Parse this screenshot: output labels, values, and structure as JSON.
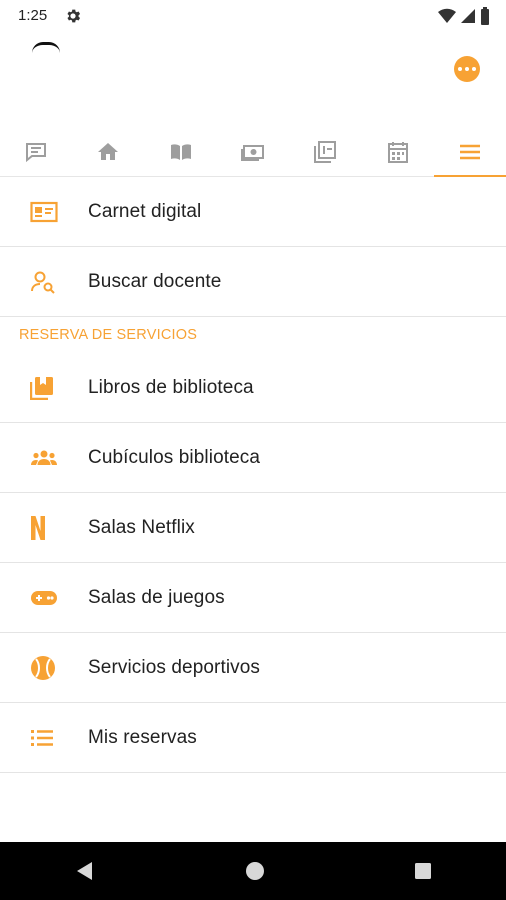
{
  "status_bar": {
    "time": "1:25"
  },
  "header": {
    "more_icon": "more-horizontal-icon"
  },
  "tabs": [
    {
      "icon": "chat-icon",
      "active": false
    },
    {
      "icon": "home-icon",
      "active": false
    },
    {
      "icon": "book-open-icon",
      "active": false
    },
    {
      "icon": "money-icon",
      "active": false
    },
    {
      "icon": "gallery-icon",
      "active": false
    },
    {
      "icon": "calendar-icon",
      "active": false
    },
    {
      "icon": "menu-icon",
      "active": true
    }
  ],
  "menu": {
    "top_items": [
      {
        "label": "Carnet digital",
        "icon": "id-card-icon"
      },
      {
        "label": "Buscar docente",
        "icon": "person-search-icon"
      }
    ],
    "section_title": "RESERVA DE SERVICIOS",
    "service_items": [
      {
        "label": "Libros de biblioteca",
        "icon": "library-books-icon"
      },
      {
        "label": "Cubículos biblioteca",
        "icon": "group-icon"
      },
      {
        "label": "Salas Netflix",
        "icon": "netflix-icon"
      },
      {
        "label": "Salas de juegos",
        "icon": "gamepad-icon"
      },
      {
        "label": "Servicios deportivos",
        "icon": "ball-icon"
      },
      {
        "label": "Mis reservas",
        "icon": "list-icon"
      }
    ]
  },
  "colors": {
    "accent": "#f7a234",
    "tab_icon": "#9e9e9e",
    "text": "#222222"
  }
}
